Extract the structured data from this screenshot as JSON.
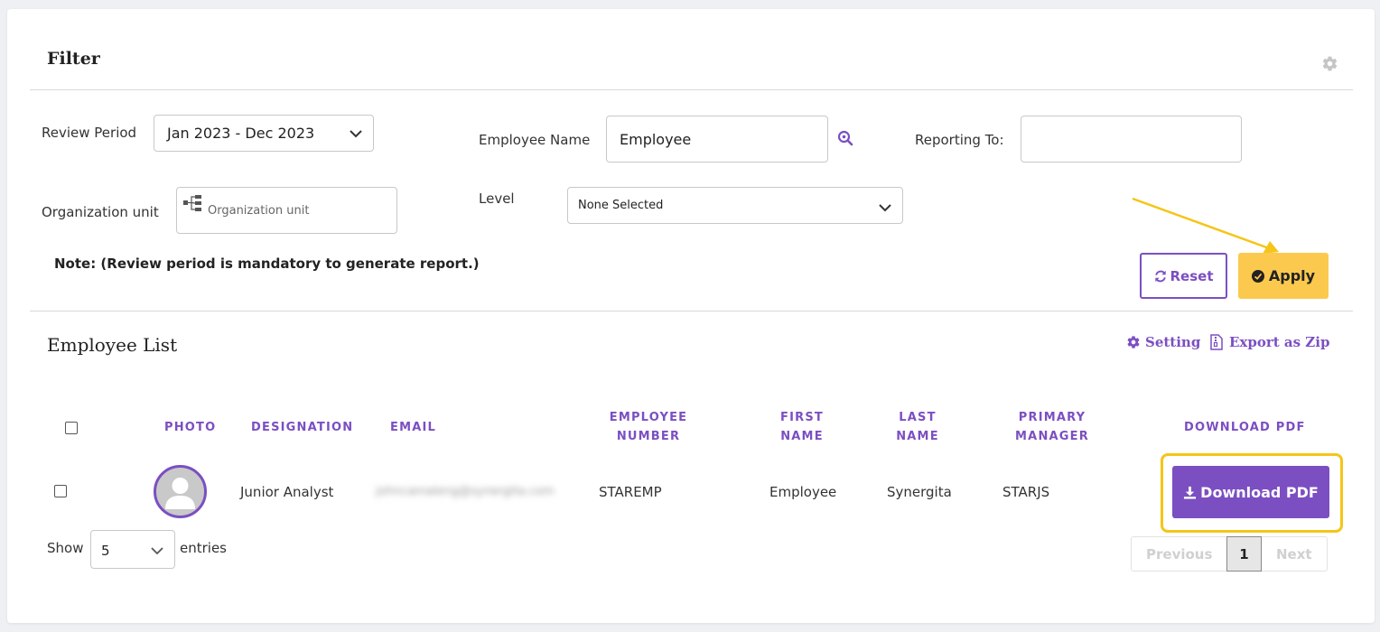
{
  "filter": {
    "title": "Filter",
    "review_period_label": "Review Period",
    "review_period_value": "Jan 2023 - Dec 2023",
    "employee_name_label": "Employee Name",
    "employee_name_value": "Employee",
    "reporting_to_label": "Reporting To:",
    "reporting_to_value": "",
    "org_unit_label": "Organization unit",
    "org_unit_placeholder": "Organization unit",
    "level_label": "Level",
    "level_value": "None Selected",
    "note": "Note: (Review period is mandatory to generate report.)",
    "reset_label": "Reset",
    "apply_label": "Apply"
  },
  "employee_list": {
    "title": "Employee List",
    "setting_label": "Setting",
    "export_label": "Export as Zip",
    "columns": {
      "photo": "PHOTO",
      "designation": "DESIGNATION",
      "email": "EMAIL",
      "employee_number_1": "EMPLOYEE",
      "employee_number_2": "NUMBER",
      "first_name_1": "FIRST",
      "first_name_2": "NAME",
      "last_name_1": "LAST",
      "last_name_2": "NAME",
      "primary_manager_1": "PRIMARY",
      "primary_manager_2": "MANAGER",
      "download_pdf": "DOWNLOAD PDF"
    },
    "rows": [
      {
        "designation": "Junior Analyst",
        "email": "johncamaleng@synergita.com",
        "employee_number": "STAREMP",
        "first_name": "Employee",
        "last_name": "Synergita",
        "primary_manager": "STARJS",
        "download_label": "Download PDF"
      }
    ]
  },
  "pagination": {
    "show_label": "Show",
    "entries_value": "5",
    "entries_label": "entries",
    "previous_label": "Previous",
    "current_page": "1",
    "next_label": "Next"
  },
  "colors": {
    "accent": "#7b4fc2",
    "apply_bg": "#fcc94f",
    "highlight": "#f5c518"
  }
}
